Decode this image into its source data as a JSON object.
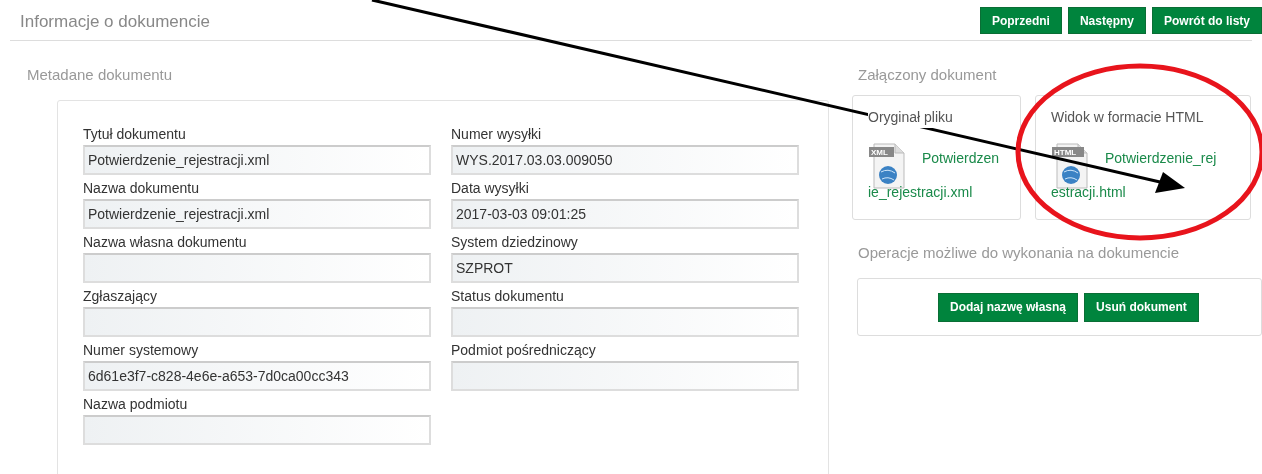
{
  "page_title": "Informacje o dokumencie",
  "nav_buttons": [
    "Poprzedni",
    "Następny",
    "Powrót do listy"
  ],
  "metadata": {
    "title": "Metadane dokumentu",
    "fields": [
      {
        "label": "Tytuł dokumentu",
        "value": "Potwierdzenie_rejestracji.xml"
      },
      {
        "label": "Numer wysyłki",
        "value": "WYS.2017.03.03.009050"
      },
      {
        "label": "Nazwa dokumentu",
        "value": "Potwierdzenie_rejestracji.xml"
      },
      {
        "label": "Data wysyłki",
        "value": "2017-03-03 09:01:25"
      },
      {
        "label": "Nazwa własna dokumentu"
      },
      {
        "label": "System dziedzinowy",
        "value": "SZPROT"
      },
      {
        "label": "Zgłaszający"
      },
      {
        "label": "Status dokumentu"
      },
      {
        "label": "Numer systemowy",
        "value": "6d61e3f7-c828-4e6e-a653-7d0ca00cc343"
      },
      {
        "label": "Podmiot pośredniczący"
      },
      {
        "label": "Nazwa podmiotu"
      }
    ]
  },
  "attachment": {
    "title": "Załączony dokument",
    "files": [
      {
        "title": "Oryginał pliku",
        "badge": "XML",
        "link": "Potwierdzenie_rejestracji.xml"
      },
      {
        "title": "Widok w formacie HTML",
        "badge": "HTML",
        "link": "Potwierdzenie_rejestracji.html"
      }
    ]
  },
  "operations": {
    "title": "Operacje możliwe do wykonania na dokumencie",
    "buttons": [
      "Dodaj nazwę własną",
      "Usuń dokument"
    ]
  }
}
